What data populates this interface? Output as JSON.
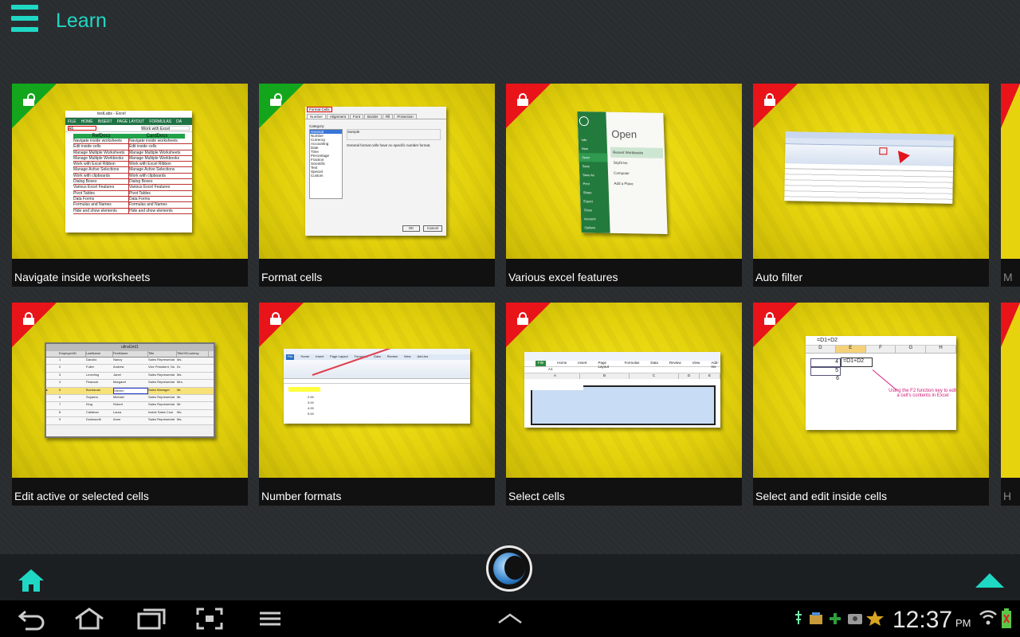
{
  "app": {
    "title": "Learn"
  },
  "lessons": [
    {
      "title": "Navigate inside worksheets",
      "locked": false
    },
    {
      "title": "Format cells",
      "locked": false
    },
    {
      "title": "Various excel features",
      "locked": true
    },
    {
      "title": "Auto filter",
      "locked": true
    },
    {
      "title": "Edit active or selected cells",
      "locked": true
    },
    {
      "title": "Number formats",
      "locked": true
    },
    {
      "title": "Select cells",
      "locked": true
    },
    {
      "title": "Select and edit inside cells",
      "locked": true
    }
  ],
  "partial_captions": [
    "M",
    "H"
  ],
  "thumbs": {
    "t1": {
      "window_title": "testLabs - Excel",
      "tabs": [
        "FILE",
        "HOME",
        "INSERT",
        "PAGE LAYOUT",
        "FORMULAS",
        "DA"
      ],
      "name_box": "A6",
      "formula": "Work with Excel",
      "headers": [
        "RefDocs",
        "CardDocs"
      ],
      "rows": [
        "Navigate inside worksheets",
        "Edit inside cells",
        "Manage Multiple Worksheets",
        "Manage Multiple Workbooks",
        "Work with Excel Ribbon",
        "Manage Active Selections",
        "Work with clipboards",
        "Dialog Boxes",
        "Various Excel Features",
        "Pivot Tables",
        "Data Forms",
        "Formulas and Names",
        "Hide and show elements"
      ]
    },
    "t2": {
      "dialog_title": "Format Cells",
      "tabs": [
        "Number",
        "Alignment",
        "Font",
        "Border",
        "Fill",
        "Protection"
      ],
      "category_label": "Category:",
      "categories": [
        "General",
        "Number",
        "Currency",
        "Accounting",
        "Date",
        "Time",
        "Percentage",
        "Fraction",
        "Scientific",
        "Text",
        "Special",
        "Custom"
      ],
      "sample_label": "Sample",
      "description": "General format cells have no specific number format.",
      "ok": "OK",
      "cancel": "Cancel"
    },
    "t3": {
      "heading": "Open",
      "menu": [
        "Info",
        "New",
        "Open",
        "Save",
        "Save As",
        "Print",
        "Share",
        "Export",
        "Close",
        "Account",
        "Options"
      ],
      "places": [
        "Recent Workbooks",
        "SkyDrive",
        "Computer",
        "Add a Place"
      ]
    },
    "t5": {
      "title": "ultraGrid1",
      "headers": [
        "EmployeeID",
        "LastName",
        "FirstName",
        "Title",
        "TitleOfCourtesy"
      ],
      "rows": [
        [
          "1",
          "Davolio",
          "Nancy",
          "Sales Representat",
          "Ms."
        ],
        [
          "2",
          "Fuller",
          "Andrew",
          "Vice President, Sa",
          "Dr."
        ],
        [
          "3",
          "Leverling",
          "Janet",
          "Sales Representat",
          "Ms."
        ],
        [
          "4",
          "Peacock",
          "Margaret",
          "Sales Representat",
          "Mrs."
        ],
        [
          "5",
          "Buchanan",
          "Steven",
          "Sales Manager",
          "Mr."
        ],
        [
          "6",
          "Suyama",
          "Michael",
          "Sales Representat",
          "Mr."
        ],
        [
          "7",
          "King",
          "Robert",
          "Sales Representat",
          "Mr."
        ],
        [
          "8",
          "Callahan",
          "Laura",
          "Inside Sales Coor",
          "Ms."
        ],
        [
          "9",
          "Dodsworth",
          "Anne",
          "Sales Representat",
          "Ms."
        ]
      ]
    },
    "t6": {
      "tabs": [
        "File",
        "Home",
        "Insert",
        "Page Layout",
        "Formulas",
        "Data",
        "Review",
        "View",
        "Add-Ins"
      ],
      "values": [
        "2.00",
        "3.00",
        "4.00",
        "5.00"
      ]
    },
    "t7": {
      "tabs": [
        "File",
        "Home",
        "Insert",
        "Page Layout",
        "Formulas",
        "Data",
        "Review",
        "View",
        "Add-Ins"
      ],
      "name_box": "A1",
      "cols": [
        "A",
        "B",
        "C",
        "D",
        "E"
      ]
    },
    "t8": {
      "formula": "=D1+D2",
      "cols": [
        "D",
        "E",
        "F",
        "G",
        "H"
      ],
      "values": [
        "4",
        "5",
        "6"
      ],
      "edit_text": "=D1+D2",
      "note": "Using the F2 function key to edit a cell's contents in Excel"
    }
  },
  "status": {
    "time": "12:37",
    "ampm": "PM"
  },
  "colors": {
    "accent": "#1fd8c4",
    "unlocked": "#13a61c",
    "locked": "#e8141a",
    "tile": "#e6d30e"
  }
}
